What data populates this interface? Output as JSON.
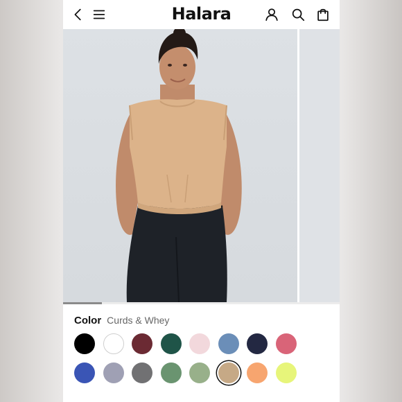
{
  "header": {
    "logo": "Halara",
    "icons": [
      "back-icon",
      "menu-icon",
      "account-icon",
      "search-icon",
      "bag-icon"
    ]
  },
  "gallery": {
    "current_image": 1,
    "progress_fraction": 0.14
  },
  "color": {
    "label": "Color",
    "selected_name": "Curds & Whey",
    "swatches": [
      {
        "hex": "#000000"
      },
      {
        "hex": "#ffffff"
      },
      {
        "hex": "#6b2a33"
      },
      {
        "hex": "#1f5448"
      },
      {
        "hex": "#f2d8dc"
      },
      {
        "hex": "#6b8eb8"
      },
      {
        "hex": "#232842"
      },
      {
        "hex": "#d96478"
      },
      {
        "hex": "#3a55b5"
      },
      {
        "hex": "#9fa0b4"
      },
      {
        "hex": "#717173"
      },
      {
        "hex": "#6a9470"
      },
      {
        "hex": "#98b08a"
      },
      {
        "hex": "#c6a986",
        "selected": true
      },
      {
        "hex": "#f7a56f"
      },
      {
        "hex": "#e7f57a"
      }
    ]
  },
  "colors": {
    "top_fabric": "#dcb38a",
    "leggings": "#1e2228",
    "backdrop": "#dde1e5"
  }
}
